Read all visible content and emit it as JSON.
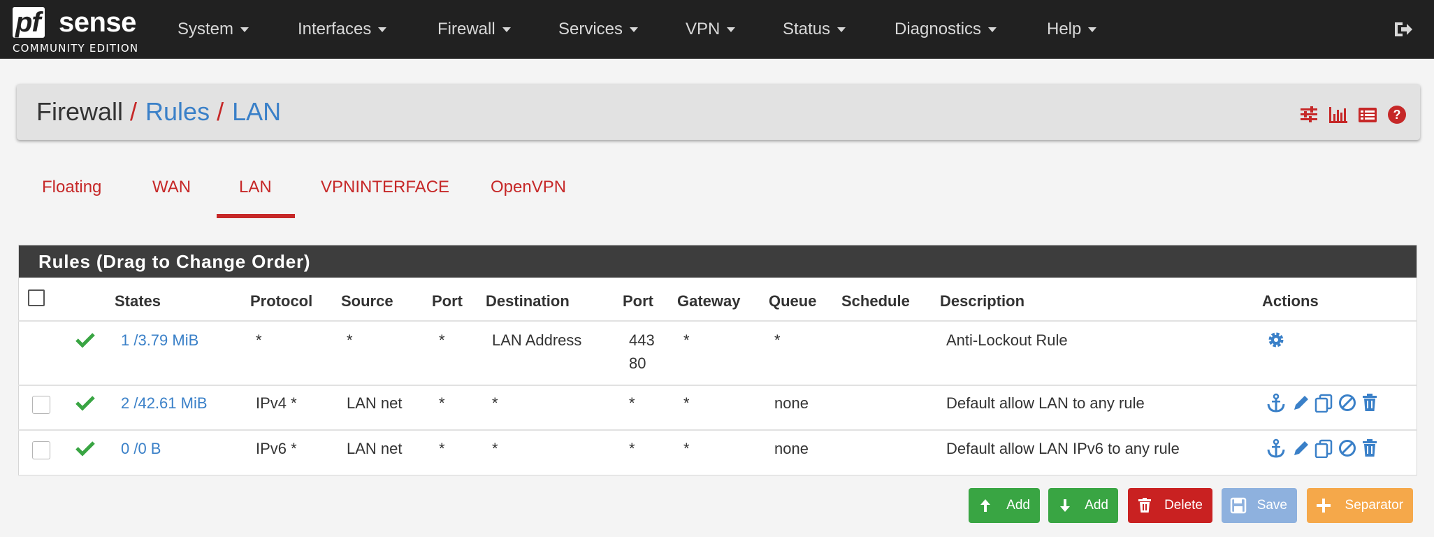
{
  "navbar": {
    "brand_pf": "pf",
    "brand_sense": "sense",
    "brand_edition": "COMMUNITY EDITION",
    "items": [
      "System",
      "Interfaces",
      "Firewall",
      "Services",
      "VPN",
      "Status",
      "Diagnostics",
      "Help"
    ],
    "logout_icon": "sign-out-icon"
  },
  "breadcrumb": {
    "root": "Firewall",
    "sep": "/",
    "level1": "Rules",
    "level2": "LAN",
    "icons": [
      "sliders-icon",
      "bar-chart-icon",
      "list-icon",
      "help-icon"
    ]
  },
  "tabs": {
    "items": [
      "Floating",
      "WAN",
      "LAN",
      "VPNINTERFACE",
      "OpenVPN"
    ],
    "active": "LAN"
  },
  "rules": {
    "heading": "Rules (Drag to Change Order)",
    "columns": [
      "States",
      "Protocol",
      "Source",
      "Port",
      "Destination",
      "Port",
      "Gateway",
      "Queue",
      "Schedule",
      "Description",
      "Actions"
    ],
    "rows": [
      {
        "states": "1 /3.79 MiB",
        "protocol": "*",
        "source": "*",
        "source_port": "*",
        "destination": "LAN Address",
        "dest_port_1": "443",
        "dest_port_2": "80",
        "gateway": "*",
        "queue": "*",
        "schedule": "",
        "description": "Anti-Lockout Rule",
        "actions": [
          "gear-icon"
        ]
      },
      {
        "states": "2 /42.61 MiB",
        "protocol": "IPv4 *",
        "source": "LAN net",
        "source_port": "*",
        "destination": "*",
        "dest_port_1": "*",
        "gateway": "*",
        "queue": "none",
        "schedule": "",
        "description": "Default allow LAN to any rule",
        "actions": [
          "anchor-icon",
          "pencil-icon",
          "copy-icon",
          "ban-icon",
          "trash-icon"
        ]
      },
      {
        "states": "0 /0 B",
        "protocol": "IPv6 *",
        "source": "LAN net",
        "source_port": "*",
        "destination": "*",
        "dest_port_1": "*",
        "gateway": "*",
        "queue": "none",
        "schedule": "",
        "description": "Default allow LAN IPv6 to any rule",
        "actions": [
          "anchor-icon",
          "pencil-icon",
          "copy-icon",
          "ban-icon",
          "trash-icon"
        ]
      }
    ]
  },
  "buttons": {
    "add_top": "Add",
    "add_bottom": "Add",
    "delete": "Delete",
    "save": "Save",
    "separator": "Separator"
  },
  "colors": {
    "navbar_bg": "#212121",
    "accent_red": "#c62828",
    "link_blue": "#3a80c8",
    "success_green": "#39a543",
    "danger_red": "#c92121",
    "save_blue": "#8eb1de",
    "separator_orange": "#f5a84a",
    "heading_bg": "#3d3d3d"
  }
}
